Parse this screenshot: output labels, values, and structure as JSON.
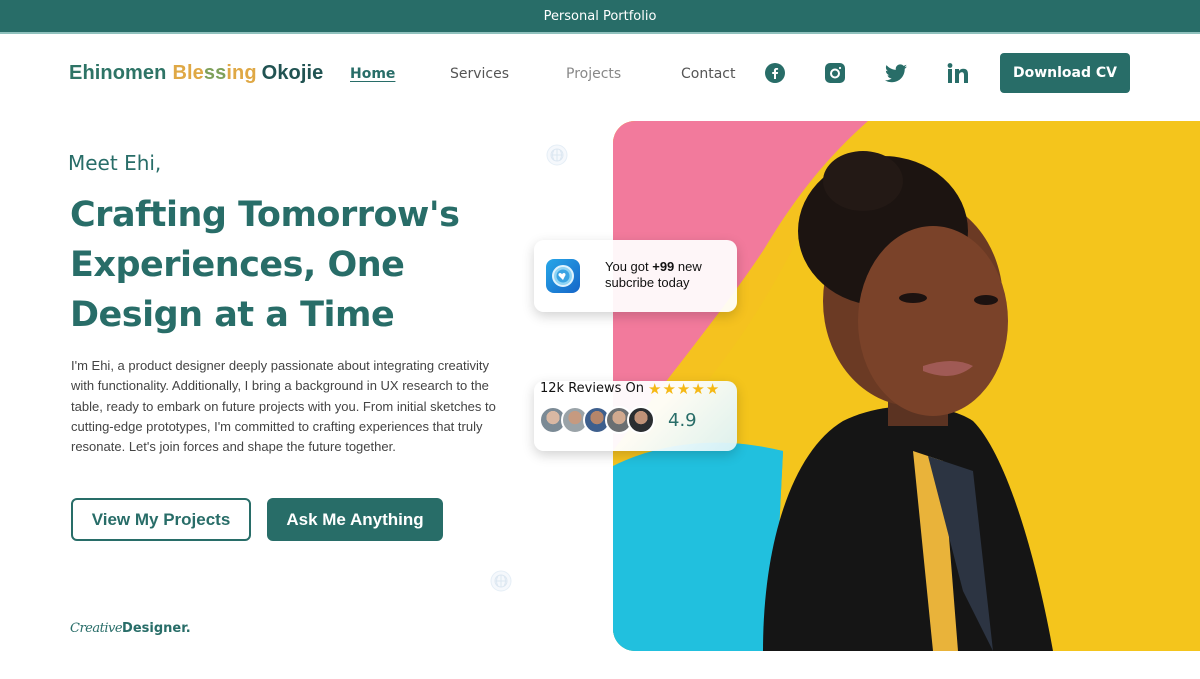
{
  "topbar": {
    "title": "Personal Portfolio"
  },
  "brand": {
    "first": "Ehinomen",
    "middle_a": "Ble",
    "middle_b": "ss",
    "middle_c": "ing",
    "last": "Okojie"
  },
  "nav": {
    "items": [
      {
        "label": "Home",
        "active": true
      },
      {
        "label": "Services",
        "active": false
      },
      {
        "label": "Projects",
        "active": false
      },
      {
        "label": "Contact",
        "active": false
      }
    ],
    "social": [
      "facebook-icon",
      "instagram-icon",
      "twitter-icon",
      "linkedin-icon"
    ],
    "cta": "Download CV"
  },
  "hero": {
    "greeting": "Meet Ehi,",
    "headline_lines": [
      "Crafting Tomorrow's",
      "Experiences, One",
      "Design at a Time"
    ],
    "bio": "I'm Ehi, a product designer deeply passionate about integrating creativity with functionality. Additionally, I bring a background in UX research to the table, ready to embark on future projects with you. From initial sketches to cutting-edge prototypes, I'm committed to crafting experiences that truly resonate. Let's join forces and shape the future together.",
    "primary_button": "View My Projects",
    "secondary_button": "Ask Me Anything",
    "signature_script": "Creative",
    "signature_bold": "Designer."
  },
  "subscribe_card": {
    "prefix": "You got ",
    "count": "+99",
    "suffix": " new subcribe today"
  },
  "reviews_card": {
    "title": "12k Reviews On",
    "stars": 5,
    "rating": "4.9",
    "reviewer_count_shown": 5
  },
  "colors": {
    "primary": "#286d68",
    "accent_gold": "#dfa845",
    "star": "#f5b915",
    "photo_pink": "#f27a9c",
    "photo_yellow": "#f4c51c",
    "photo_cyan": "#19b8d8"
  }
}
